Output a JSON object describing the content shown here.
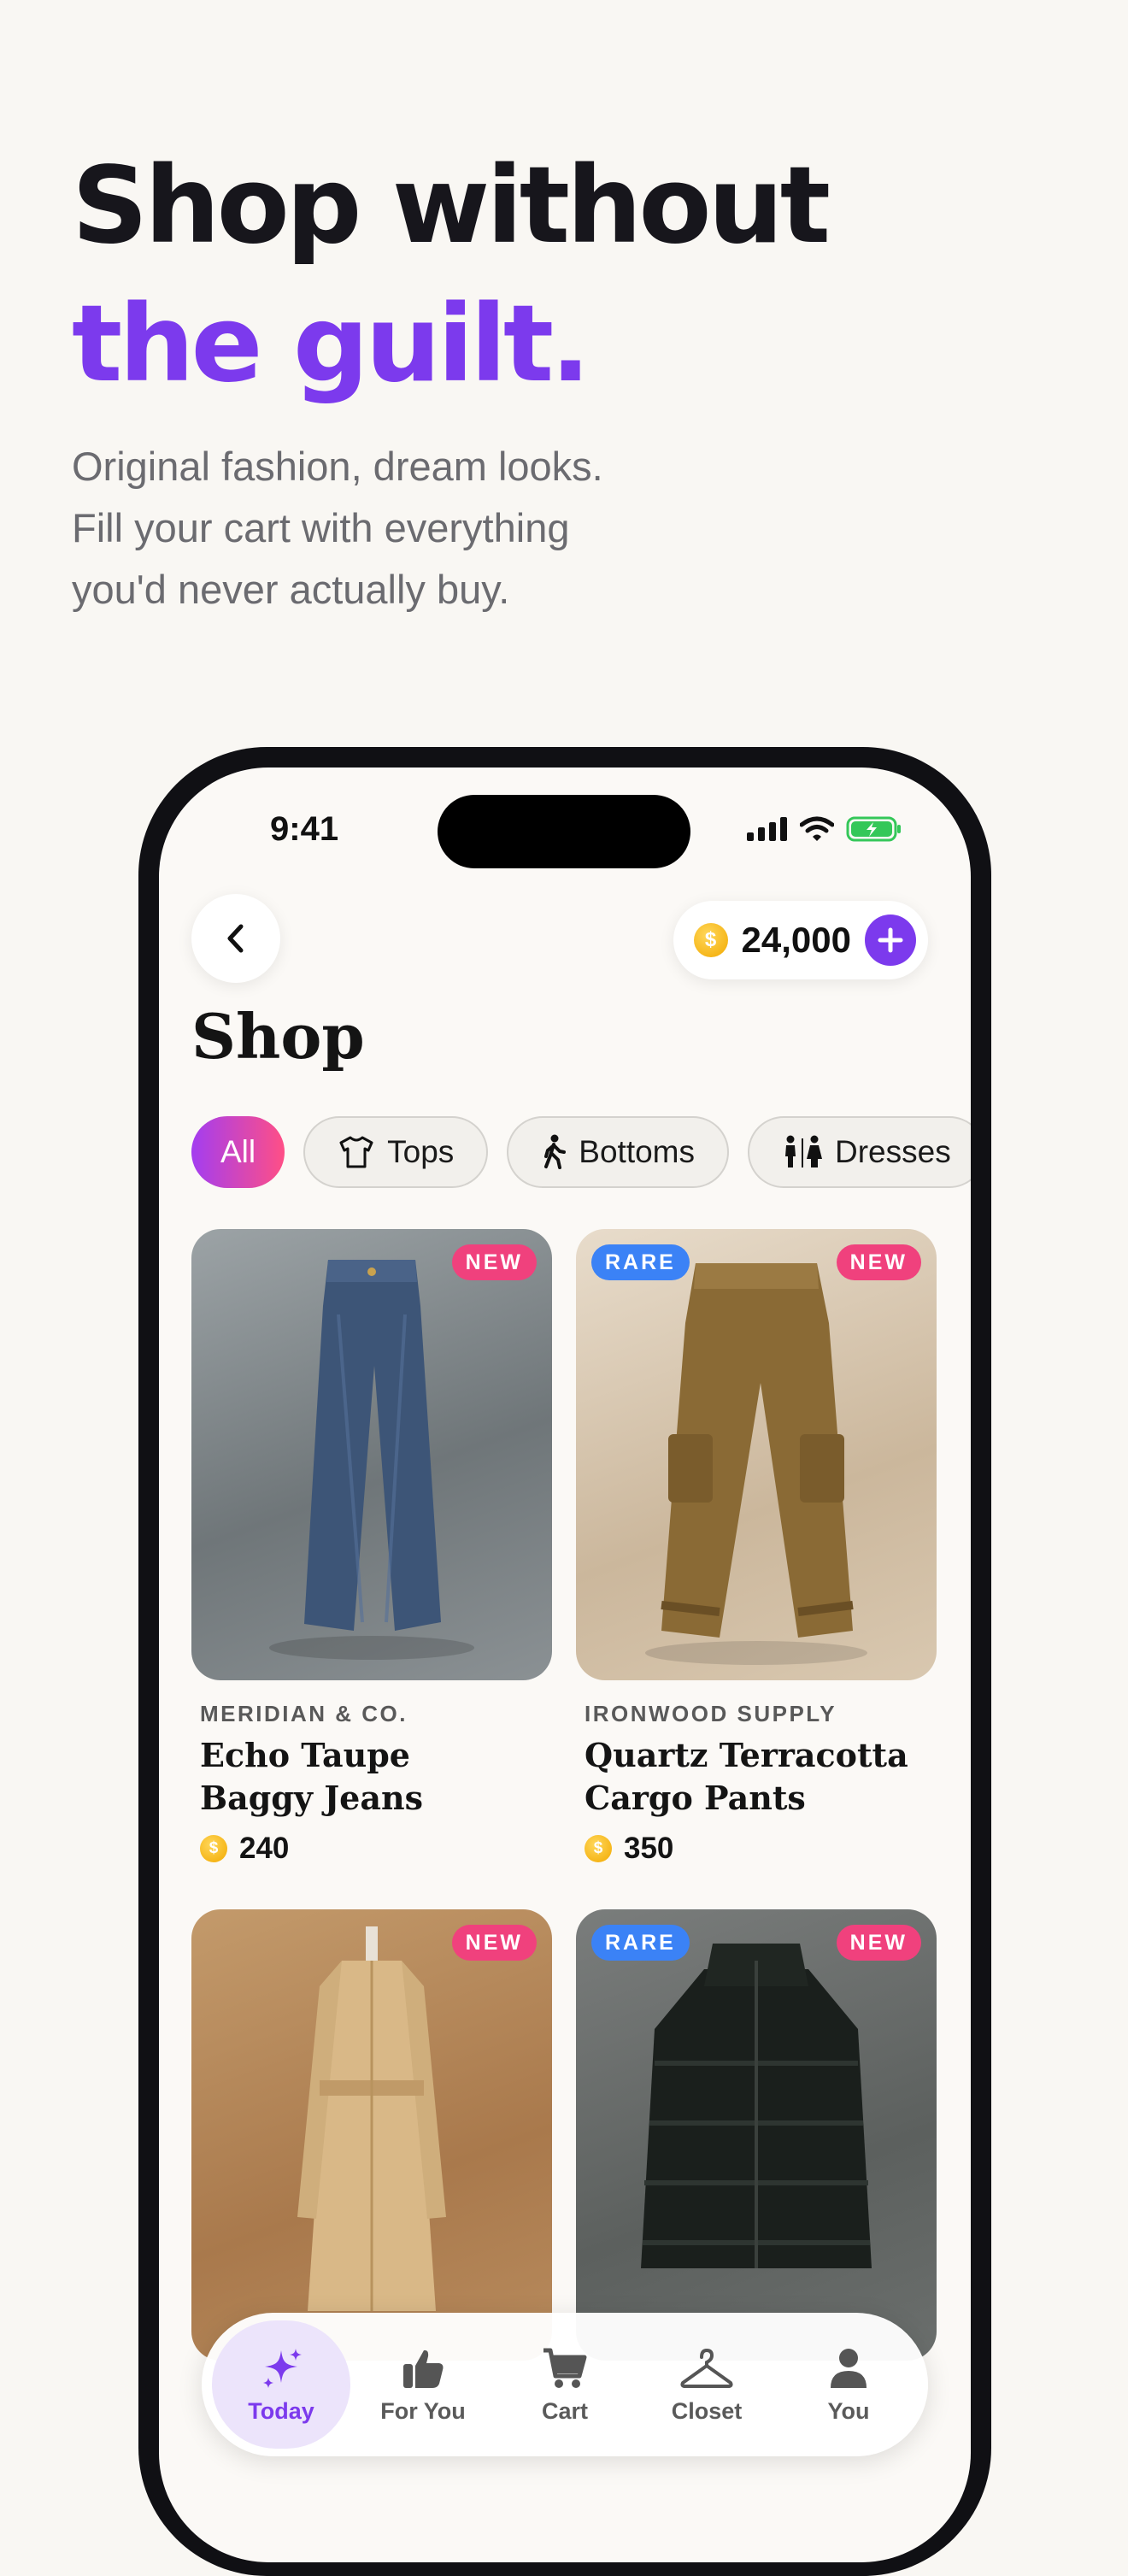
{
  "hero": {
    "line1": "Shop without",
    "line2": "the guilt.",
    "subtitle": [
      "Original fashion, dream looks.",
      "Fill your cart with everything",
      "you'd never actually buy."
    ]
  },
  "status": {
    "time": "9:41"
  },
  "header": {
    "coin_symbol": "$",
    "coin_balance": "24,000"
  },
  "shop": {
    "title": "Shop",
    "filters": [
      "All",
      "Tops",
      "Bottoms",
      "Dresses"
    ],
    "active_filter": "All"
  },
  "products": [
    {
      "badges": [
        "NEW"
      ],
      "brand": "MERIDIAN & CO.",
      "name": [
        "Echo Taupe",
        "Baggy Jeans"
      ],
      "price": "240"
    },
    {
      "badges": [
        "RARE",
        "NEW"
      ],
      "brand": "IRONWOOD SUPPLY",
      "name": [
        "Quartz Terracotta",
        "Cargo Pants"
      ],
      "price": "350"
    },
    {
      "badges": [
        "NEW"
      ]
    },
    {
      "badges": [
        "RARE",
        "NEW"
      ]
    }
  ],
  "tabbar": {
    "tabs": [
      "Today",
      "For You",
      "Cart",
      "Closet",
      "You"
    ],
    "active": "Today"
  },
  "colors": {
    "accent": "#7c3aed",
    "new_badge": "#f0417d",
    "rare_badge": "#3b82f6",
    "background": "#f9f7f3"
  }
}
